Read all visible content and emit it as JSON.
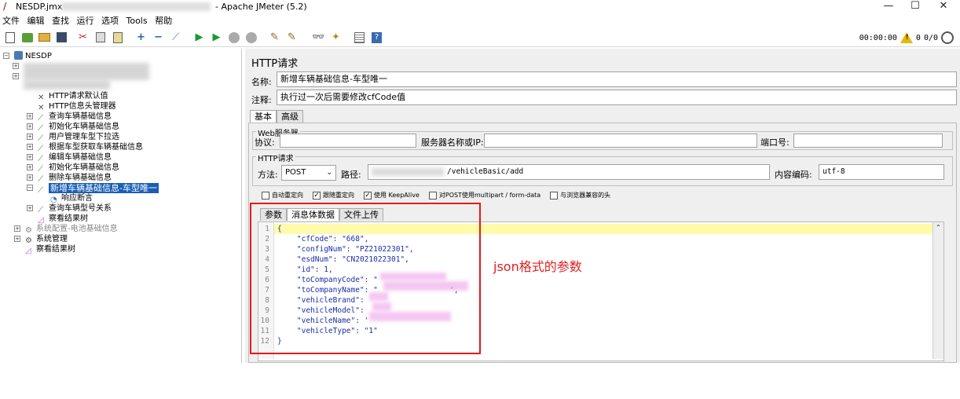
{
  "window": {
    "file_name": "NESDP.jmx",
    "app_title": "- Apache JMeter (5.2)"
  },
  "menu": [
    "文件",
    "编辑",
    "查找",
    "运行",
    "选项",
    "Tools",
    "帮助"
  ],
  "toolbar_status": {
    "timer": "00:00:00",
    "warnings": "0",
    "threads": "0/0"
  },
  "tree": {
    "root": "NESDP",
    "items": [
      {
        "label": "HTTP请求默认值"
      },
      {
        "label": "HTTP信息头管理器"
      },
      {
        "label": "查询车辆基础信息"
      },
      {
        "label": "初始化车辆基础信息"
      },
      {
        "label": "用户管理车型下拉选"
      },
      {
        "label": "根据车型获取车辆基础信息"
      },
      {
        "label": "编辑车辆基础信息"
      },
      {
        "label": "初始化车辆基础信息"
      },
      {
        "label": "删除车辆基础信息"
      },
      {
        "label": "新增车辆基础信息-车型唯一"
      },
      {
        "label": "响应断言"
      },
      {
        "label": "查询车辆型号关系"
      },
      {
        "label": "察看结果树"
      },
      {
        "label": "系统配置-电池基础信息"
      },
      {
        "label": "系统管理"
      },
      {
        "label": "察看结果树"
      }
    ]
  },
  "panel": {
    "header": "HTTP请求",
    "name_label": "名称:",
    "name_value": "新增车辆基础信息-车型唯一",
    "comment_label": "注释:",
    "comment_value": "执行过一次后需要修改cfCode值",
    "tabs": [
      "基本",
      "高级"
    ],
    "web_server": {
      "title": "Web服务器",
      "protocol_label": "协议:",
      "server_label": "服务器名称或IP:",
      "port_label": "端口号:"
    },
    "http_request": {
      "title": "HTTP请求",
      "method_label": "方法:",
      "method_value": "POST",
      "path_label": "路径:",
      "path_value": "/vehicleBasic/add",
      "encoding_label": "内容编码:",
      "encoding_value": "utf-8"
    },
    "checkboxes": [
      {
        "label": "自动重定向",
        "checked": false
      },
      {
        "label": "跟随重定向",
        "checked": true
      },
      {
        "label": "使用 KeepAlive",
        "checked": true
      },
      {
        "label": "对POST使用multipart / form-data",
        "checked": false
      },
      {
        "label": "与浏览器兼容的头",
        "checked": false
      }
    ],
    "subtabs": [
      "参数",
      "消息体数据",
      "文件上传"
    ],
    "body_lines": [
      {
        "n": "1",
        "text": "{"
      },
      {
        "n": "2",
        "text": "    \"cfCode\": \"668\","
      },
      {
        "n": "3",
        "text": "    \"configNum\": \"PZ21022301\","
      },
      {
        "n": "4",
        "text": "    \"esdNum\": \"CN2021022301\","
      },
      {
        "n": "5",
        "text": "    \"id\": 1,"
      },
      {
        "n": "6",
        "text": "    \"toCompanyCode\": \""
      },
      {
        "n": "7",
        "text": "    \"toCompanyName\": \"                \","
      },
      {
        "n": "8",
        "text": "    \"vehicleBrand\":"
      },
      {
        "n": "9",
        "text": "    \"vehicleModel\":"
      },
      {
        "n": "10",
        "text": "    \"vehicleName\": '"
      },
      {
        "n": "11",
        "text": "    \"vehicleType\": \"1\""
      },
      {
        "n": "12",
        "text": "}"
      }
    ]
  },
  "annotation": "json格式的参数"
}
